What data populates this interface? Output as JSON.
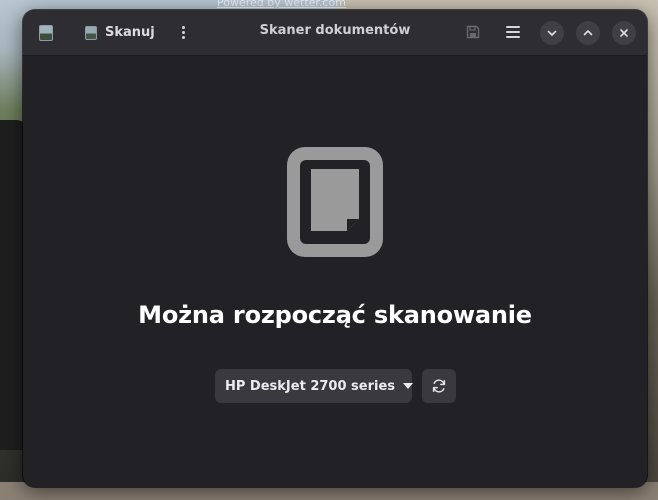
{
  "desktop": {
    "watermark": "Powered by wetter.com"
  },
  "window": {
    "title": "Skaner dokumentów",
    "scan_button_label": "Skanuj",
    "icons": {
      "app": "scanner-app-icon",
      "scan": "scanner-app-icon",
      "menu": "vertical-dots-icon",
      "save": "save-icon",
      "main_menu": "hamburger-icon",
      "minimize": "chevron-down-icon",
      "maximize": "chevron-up-icon",
      "close": "close-icon"
    }
  },
  "content": {
    "status_title": "Można rozpocząć skanowanie",
    "status_icon": "document-scanner-icon",
    "device_select": {
      "selected": "HP DeskJet 2700 series"
    },
    "refresh_icon": "refresh-icon"
  },
  "colors": {
    "window_bg": "#222226",
    "titlebar_bg": "#2e2e32",
    "control_bg": "#3a3a3e",
    "icon_gray": "#9a9a9a",
    "text_primary": "#ffffff"
  }
}
